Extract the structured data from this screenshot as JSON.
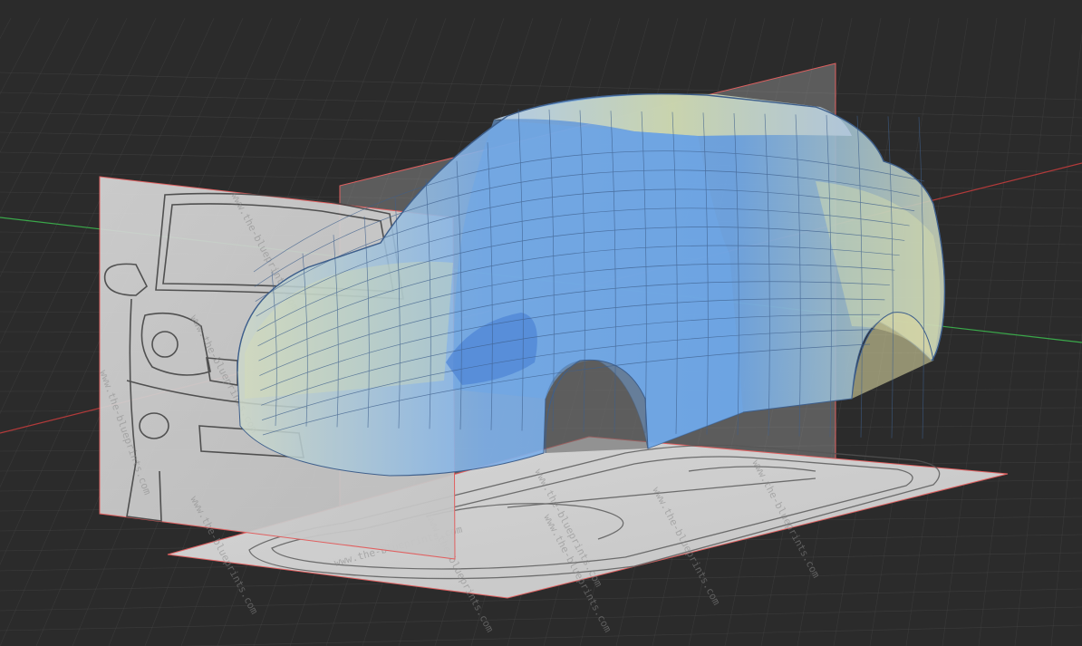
{
  "viewport": {
    "background_color": "#2b2b2b",
    "grid_color": "#4a4a4a",
    "axis_x_color": "#b23a3a",
    "axis_y_color": "#3aa84a"
  },
  "model": {
    "body_color": "#6ea6e6",
    "highlight_color": "#d9dfae",
    "wire_color": "#3e5f8c"
  },
  "reference_images": {
    "border_color": "#e06060",
    "watermarks": {
      "front": [
        "www.the-blueprints.com",
        "www.the-blueprints.com",
        "www.the-blueprints.com",
        "www.the-blueprints.com"
      ],
      "side": [
        "www.the-blueprints.com",
        "www.the-blueprints.com"
      ],
      "top": [
        "www.the-blueprints.com",
        "www.the-blueprints.com",
        "www.the-blueprints.com",
        "www.the-blueprints.com",
        "www.the-blueprints.com",
        "www.the-blueprints.com"
      ]
    }
  }
}
